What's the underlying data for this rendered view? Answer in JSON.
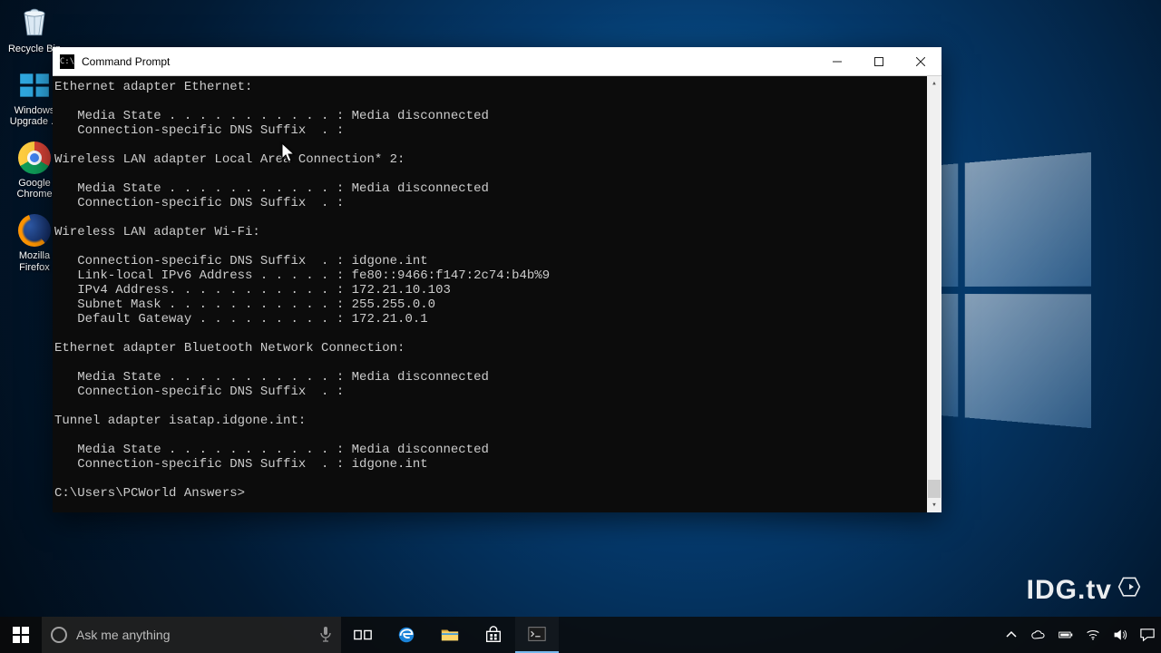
{
  "desktop": {
    "icons": [
      {
        "name": "recycle-bin",
        "label": "Recycle Bin"
      },
      {
        "name": "windows-upgrade",
        "label": "Windows\nUpgrade ..."
      },
      {
        "name": "google-chrome",
        "label": "Google\nChrome"
      },
      {
        "name": "mozilla-firefox",
        "label": "Mozilla\nFirefox"
      }
    ]
  },
  "window": {
    "title": "Command Prompt",
    "output": "Ethernet adapter Ethernet:\n\n   Media State . . . . . . . . . . . : Media disconnected\n   Connection-specific DNS Suffix  . :\n\nWireless LAN adapter Local Area Connection* 2:\n\n   Media State . . . . . . . . . . . : Media disconnected\n   Connection-specific DNS Suffix  . :\n\nWireless LAN adapter Wi-Fi:\n\n   Connection-specific DNS Suffix  . : idgone.int\n   Link-local IPv6 Address . . . . . : fe80::9466:f147:2c74:b4b%9\n   IPv4 Address. . . . . . . . . . . : 172.21.10.103\n   Subnet Mask . . . . . . . . . . . : 255.255.0.0\n   Default Gateway . . . . . . . . . : 172.21.0.1\n\nEthernet adapter Bluetooth Network Connection:\n\n   Media State . . . . . . . . . . . : Media disconnected\n   Connection-specific DNS Suffix  . :\n\nTunnel adapter isatap.idgone.int:\n\n   Media State . . . . . . . . . . . : Media disconnected\n   Connection-specific DNS Suffix  . : idgone.int\n\nC:\\Users\\PCWorld Answers>"
  },
  "taskbar": {
    "search_placeholder": "Ask me anything"
  },
  "watermark": "IDG.tv"
}
